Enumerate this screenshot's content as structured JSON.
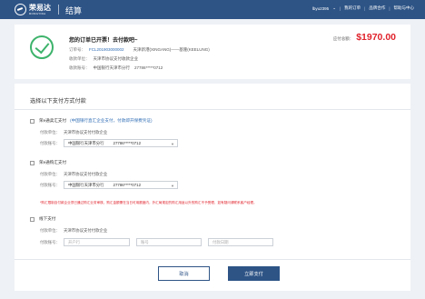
{
  "header": {
    "logo_cn": "荣易达",
    "logo_en": "RONGYIDA",
    "page_title": "结算",
    "user": "lbyu2395",
    "nav": [
      "我的订单",
      "品牌合作",
      "帮助与中心"
    ]
  },
  "order": {
    "headline": "您的订单已开票！去付款吧~",
    "order_no_label": "订单号：",
    "order_no": "FCL201903000002",
    "route": "天津新港(XINGANG)——基隆(KEELUNG)",
    "payee_unit_label": "收款单位：",
    "payee_unit": "天津市协议支付收款企业",
    "payee_account_label": "收款账号：",
    "payee_bank": "中国银行天津市分行",
    "payee_account": "27786*****0712",
    "amount_label": "应付总额：",
    "amount": "$1970.00"
  },
  "payment": {
    "section_title": "选择以下支付方式付款",
    "methods": [
      {
        "label": "荣e通卖汇支付",
        "hint": "(中国银行直汇企业支付，付款即开保费凭证)",
        "unit_label": "付款单位：",
        "unit": "天津市协议支付付款企业",
        "account_label": "付款账号：",
        "bank": "中国银行天津市分行",
        "account": "27786*****0712"
      },
      {
        "label": "荣e通购汇支付",
        "unit_label": "付款单位：",
        "unit": "天津市协议支付付款企业",
        "account_label": "付款账号：",
        "bank": "中国银行天津市分行",
        "account": "27786*****0712",
        "warning": "*购汇限制自付款企业须已通过购汇业务审核，购汇金额需在当日可用额度内，外汇局规定的购汇用途以外的购汇不予受理，如有疑问请联系客户经理。"
      },
      {
        "label": "线下支付",
        "unit_label": "付款单位：",
        "unit": "天津市协议支付付款企业",
        "account_label": "付款账号：",
        "placeholder_account": "开户行",
        "placeholder_number": "账号",
        "placeholder_date": "付款日期"
      }
    ],
    "cancel_label": "取消",
    "pay_label": "立即支付"
  }
}
